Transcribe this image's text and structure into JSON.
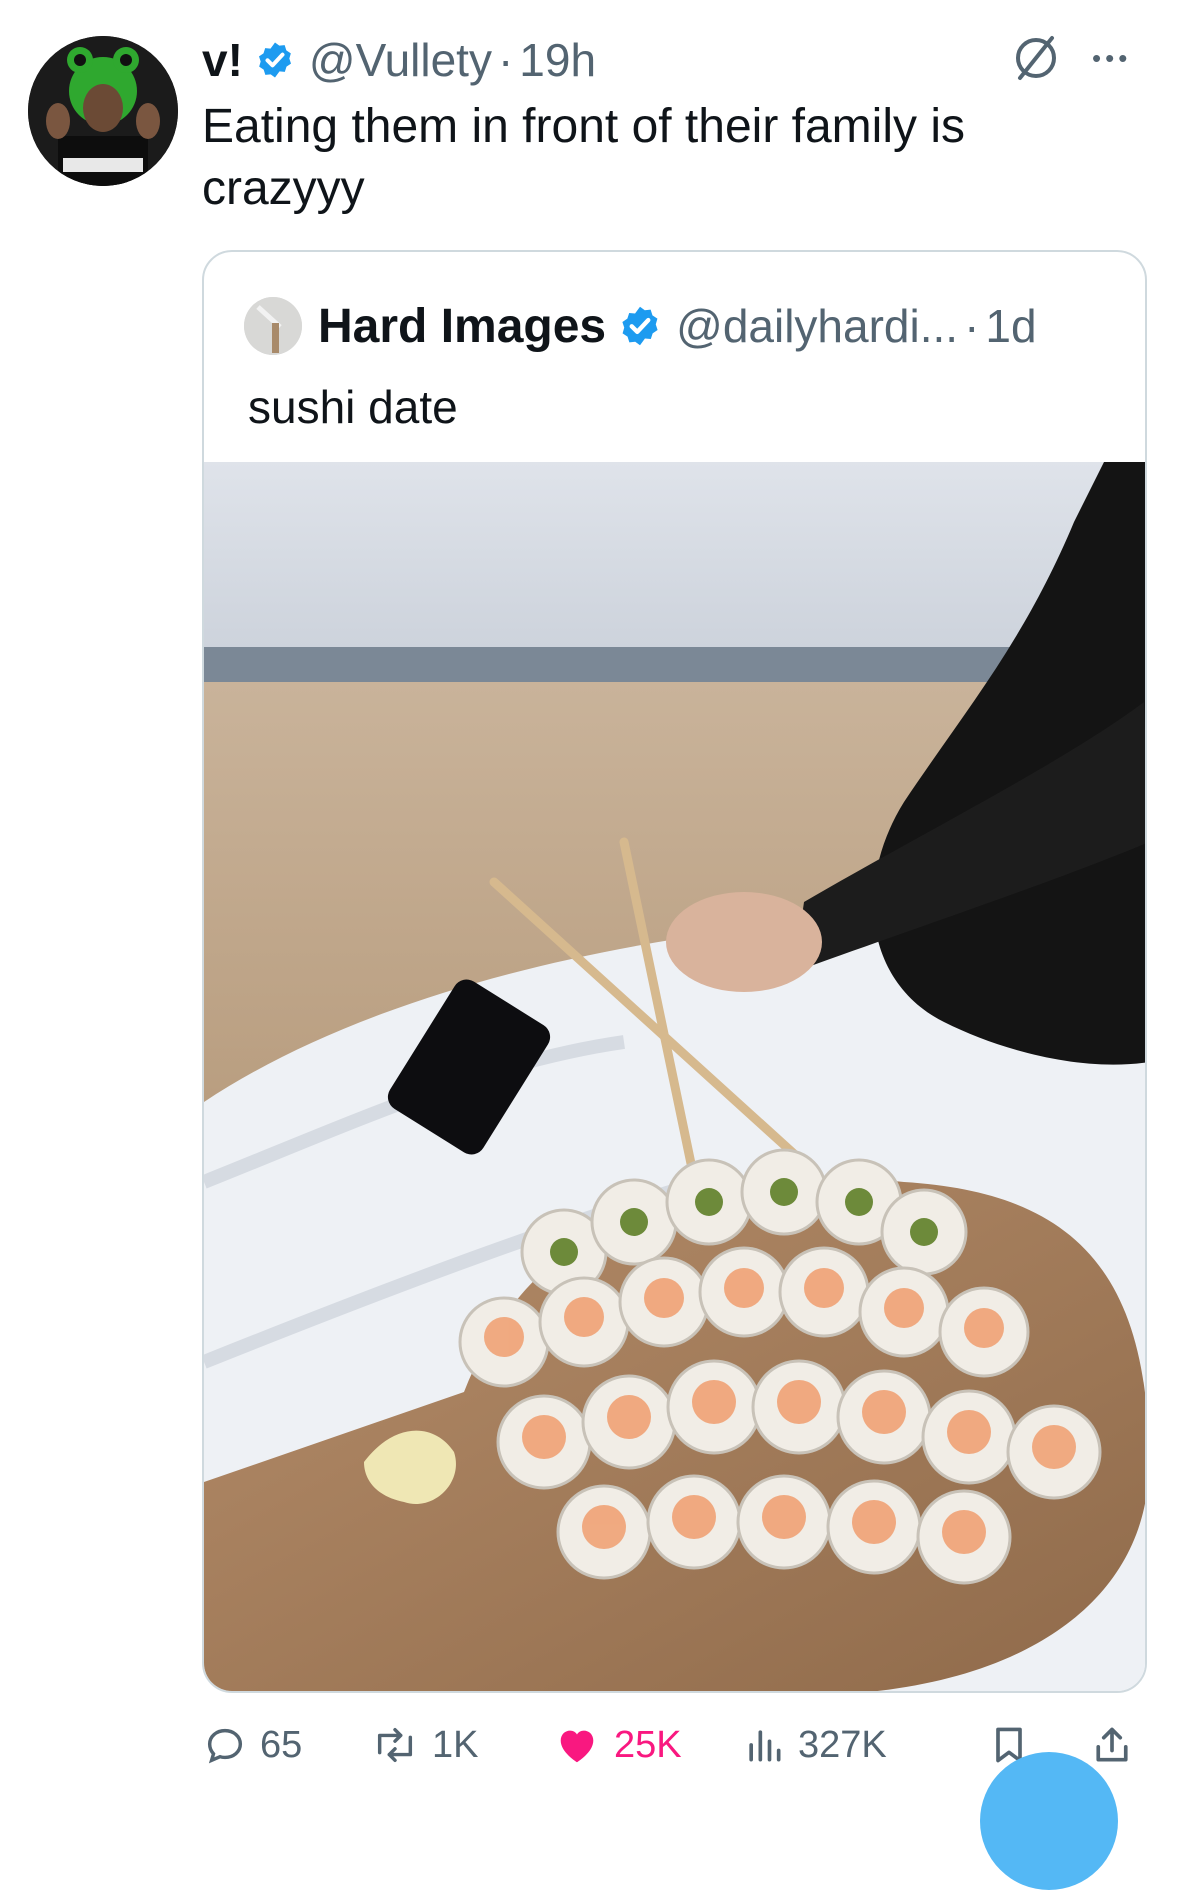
{
  "tweet": {
    "display_name": "v!",
    "handle": "@Vullety",
    "separator": "·",
    "time": "19h",
    "text": "Eating them in front of their family is crazyyy"
  },
  "quoted_tweet": {
    "display_name": "Hard Images",
    "handle": "@dailyhardi...",
    "separator": "·",
    "time": "1d",
    "text": "sushi date",
    "image_icon": "sushi-beach-photo"
  },
  "actions": {
    "replies": "65",
    "reposts": "1K",
    "likes": "25K",
    "views": "327K"
  },
  "colors": {
    "verified": "#1d9bf0",
    "like_active": "#f91880",
    "secondary_text": "#536471",
    "border": "#cfd9de"
  }
}
